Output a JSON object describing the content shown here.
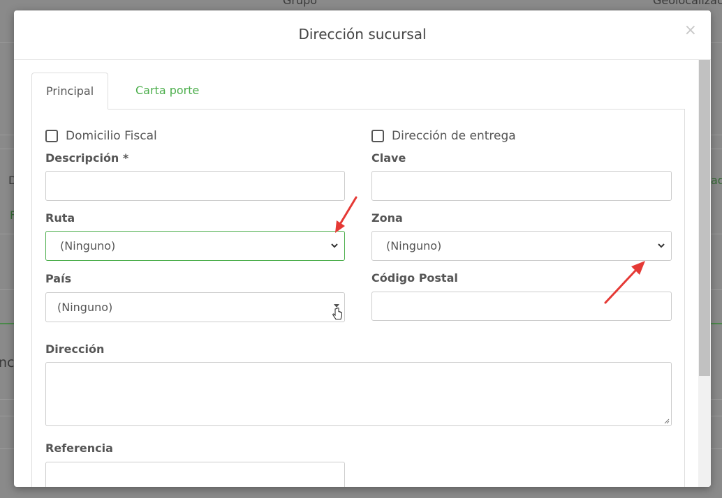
{
  "modal": {
    "title": "Dirección sucursal",
    "close_symbol": "×"
  },
  "tabs": [
    {
      "label": "Principal",
      "active": true
    },
    {
      "label": "Carta porte",
      "active": false
    }
  ],
  "form": {
    "domicilio_fiscal": {
      "label": "Domicilio Fiscal",
      "checked": false
    },
    "direccion_entrega": {
      "label": "Dirección de entrega",
      "checked": false
    },
    "descripcion": {
      "label": "Descripción *",
      "value": ""
    },
    "clave": {
      "label": "Clave",
      "value": ""
    },
    "ruta": {
      "label": "Ruta",
      "value": "(Ninguno)"
    },
    "zona": {
      "label": "Zona",
      "value": "(Ninguno)"
    },
    "pais": {
      "label": "País",
      "value": "(Ninguno)"
    },
    "codigo_postal": {
      "label": "Código Postal",
      "value": ""
    },
    "direccion": {
      "label": "Dirección",
      "value": ""
    },
    "referencia": {
      "label": "Referencia",
      "value": ""
    }
  },
  "background": {
    "col1": "Grupo",
    "col2": "Geolocalizac",
    "t1": "D",
    "t2": "ad",
    "t3": "F",
    "t4": "nc"
  },
  "colors": {
    "accent_green": "#4cae4c",
    "annotation_red": "#e53935"
  }
}
